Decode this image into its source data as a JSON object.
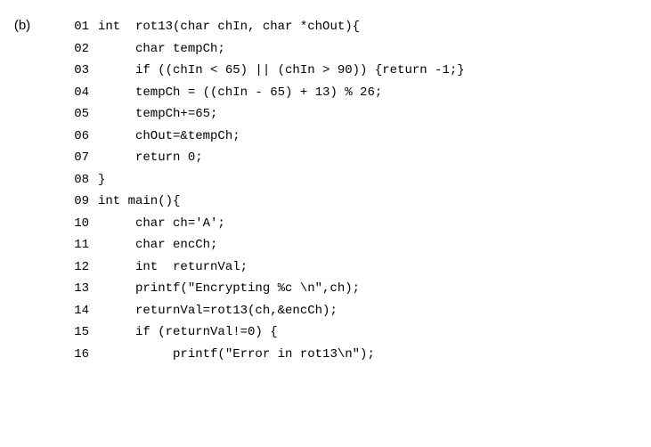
{
  "label": "(b)",
  "lines": [
    {
      "num": "01",
      "code": "int  rot13(char chIn, char *chOut){"
    },
    {
      "num": "02",
      "code": "     char tempCh;"
    },
    {
      "num": "03",
      "code": "     if ((chIn < 65) || (chIn > 90)) {return -1;}"
    },
    {
      "num": "04",
      "code": "     tempCh = ((chIn - 65) + 13) % 26;"
    },
    {
      "num": "05",
      "code": "     tempCh+=65;"
    },
    {
      "num": "06",
      "code": "     chOut=&tempCh;"
    },
    {
      "num": "07",
      "code": "     return 0;"
    },
    {
      "num": "08",
      "code": "}"
    },
    {
      "num": "09",
      "code": "int main(){"
    },
    {
      "num": "10",
      "code": "     char ch='A';"
    },
    {
      "num": "11",
      "code": "     char encCh;"
    },
    {
      "num": "12",
      "code": "     int  returnVal;"
    },
    {
      "num": "13",
      "code": "     printf(\"Encrypting %c \\n\",ch);"
    },
    {
      "num": "14",
      "code": "     returnVal=rot13(ch,&encCh);"
    },
    {
      "num": "15",
      "code": "     if (returnVal!=0) {"
    },
    {
      "num": "16",
      "code": "          printf(\"Error in rot13\\n\");"
    }
  ]
}
